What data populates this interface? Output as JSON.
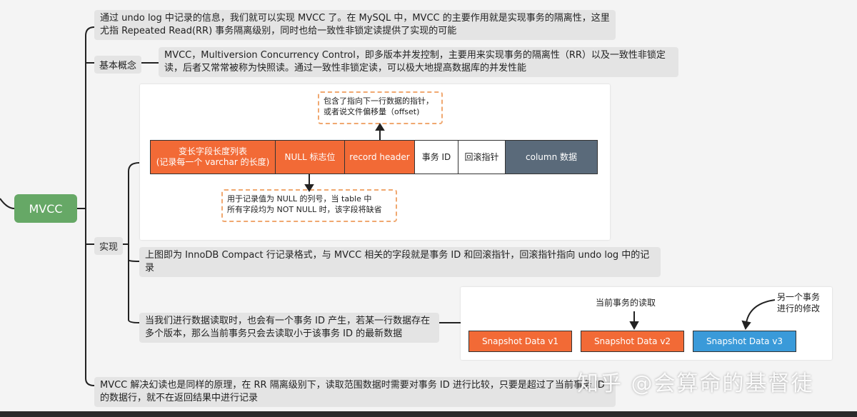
{
  "root": {
    "label": "MVCC"
  },
  "branches": {
    "intro": "通过 undo log 中记录的信息，我们就可以实现 MVCC 了。在 MySQL 中，MVCC 的主要作用就是实现事务的隔离性，这里尤指 Repeated Read(RR) 事务隔离级别，同时也给一致性非锁定读提供了实现的可能",
    "concept_label": "基本概念",
    "concept_text": "MVCC，Multiversion Concurrency Control，即多版本并发控制，主要用来实现事务的隔离性（RR）以及一致性非锁定读，后者又常常被称为快照读。通过一致性非锁定读，可以极大地提高数据库的并发性能",
    "impl_label": "实现",
    "impl_note1": "上图即为 InnoDB Compact 行记录格式，与 MVCC 相关的字段就是事务 ID 和回滚指针，回滚指针指向 undo log 中的记录",
    "impl_note2": "当我们进行数据读取时，也会有一个事务 ID 产生，若某一行数据存在多个版本，那么当前事务只会去读取小于该事务 ID 的最新数据",
    "rr_note": "MVCC 解决幻读也是同样的原理，在 RR 隔离级别下，读取范围数据时需要对事务 ID 进行比较，只要是超过了当前事务 ID 的数据行，就不在返回结果中进行记录"
  },
  "row_format": {
    "cells": [
      "变长字段长度列表\n(记录每一个 varchar 的长度)",
      "NULL 标志位",
      "record header",
      "事务 ID",
      "回滚指针",
      "column 数据"
    ],
    "header_note": "包含了指向下一行数据的指针，\n或者说文件偏移量（offset)",
    "null_note": "用于记录值为 NULL 的列号，当 table 中\n所有字段均为 NOT NULL 时，该字段将缺省"
  },
  "snapshots": {
    "items": [
      "Snapshot Data v1",
      "Snapshot Data v2",
      "Snapshot Data v3"
    ],
    "current_read": "当前事务的读取",
    "other_txn": "另一个事务\n进行的修改"
  },
  "watermark": "知乎 @会算命的基督徒",
  "colors": {
    "root": "#66a866",
    "orange": "#f26a36",
    "slate": "#5a6a7a",
    "blue": "#3a9ad9",
    "dashed": "#f0a870"
  }
}
